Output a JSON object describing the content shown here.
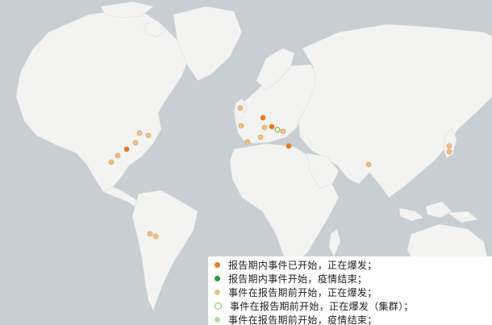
{
  "legend": {
    "items": [
      {
        "label": "报告期内事件已开始，正在爆发；",
        "color": "#e87b1e"
      },
      {
        "label": "报告期内事件开始，疫情结束；",
        "color": "#2e9b34"
      },
      {
        "label": "事件在报告期前开始，正在爆发；",
        "color": "#ecc08a"
      },
      {
        "label": "事件在报告期前开始，正在爆发（集群）；",
        "color": "#8fbf58"
      },
      {
        "label": "事件在报告期前开始，疫情结束；",
        "color": "#b6dfa6"
      }
    ]
  },
  "colors": {
    "ocean": "#c7cfd4",
    "land": "#f3f3f1",
    "border": "#d8d8d8"
  },
  "markers": [
    {
      "kind": "started-active",
      "region": "Eastern US"
    },
    {
      "kind": "prior-active",
      "region": "Canada east"
    },
    {
      "kind": "prior-active",
      "region": "Canada east"
    },
    {
      "kind": "prior-active",
      "region": "US northeast"
    },
    {
      "kind": "prior-active",
      "region": "US southeast"
    },
    {
      "kind": "prior-active",
      "region": "US south"
    },
    {
      "kind": "started-active",
      "region": "Germany"
    },
    {
      "kind": "prior-active",
      "region": "UK"
    },
    {
      "kind": "prior-active",
      "region": "France"
    },
    {
      "kind": "prior-active",
      "region": "Spain"
    },
    {
      "kind": "started-active",
      "region": "Poland"
    },
    {
      "kind": "prior-active",
      "region": "Central Europe"
    },
    {
      "kind": "prior-active",
      "region": "Balkans"
    },
    {
      "kind": "prior-cluster",
      "region": "Hungary"
    },
    {
      "kind": "prior-active",
      "region": "Ukraine"
    },
    {
      "kind": "started-active",
      "region": "Turkey"
    },
    {
      "kind": "prior-active",
      "region": "India"
    },
    {
      "kind": "prior-active",
      "region": "Japan"
    },
    {
      "kind": "prior-active",
      "region": "Japan south"
    },
    {
      "kind": "prior-active",
      "region": "Argentina"
    },
    {
      "kind": "prior-active",
      "region": "Brazil south"
    }
  ]
}
